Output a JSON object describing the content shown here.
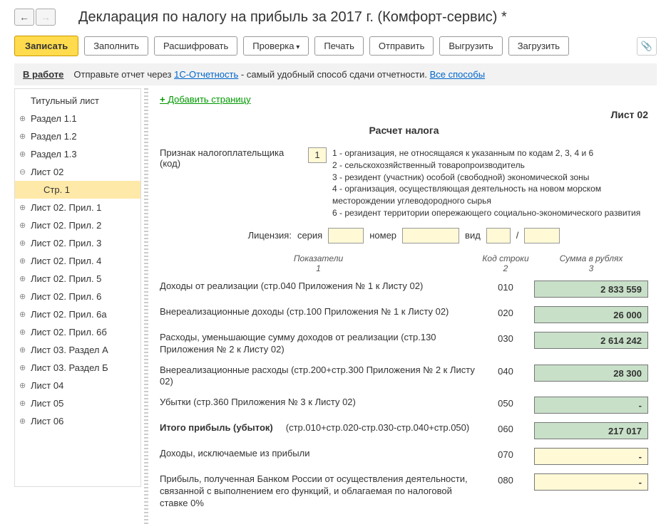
{
  "title": "Декларация по налогу на прибыль за 2017 г. (Комфорт-сервис) *",
  "toolbar": {
    "write": "Записать",
    "fill": "Заполнить",
    "decode": "Расшифровать",
    "check": "Проверка",
    "print": "Печать",
    "send": "Отправить",
    "export": "Выгрузить",
    "import": "Загрузить"
  },
  "info": {
    "status": "В работе",
    "text1": "Отправьте отчет через ",
    "link1": "1С-Отчетность",
    "text2": " - самый удобный способ сдачи отчетности. ",
    "link2": "Все способы"
  },
  "tree": [
    {
      "label": "Титульный лист",
      "lvl": 1,
      "exp": ""
    },
    {
      "label": "Раздел 1.1",
      "lvl": 1,
      "exp": "⊕"
    },
    {
      "label": "Раздел 1.2",
      "lvl": 1,
      "exp": "⊕"
    },
    {
      "label": "Раздел 1.3",
      "lvl": 1,
      "exp": "⊕"
    },
    {
      "label": "Лист 02",
      "lvl": 1,
      "exp": "⊖"
    },
    {
      "label": "Стр. 1",
      "lvl": 2,
      "exp": "",
      "active": true
    },
    {
      "label": "Лист 02. Прил. 1",
      "lvl": 1,
      "exp": "⊕"
    },
    {
      "label": "Лист 02. Прил. 2",
      "lvl": 1,
      "exp": "⊕"
    },
    {
      "label": "Лист 02. Прил. 3",
      "lvl": 1,
      "exp": "⊕"
    },
    {
      "label": "Лист 02. Прил. 4",
      "lvl": 1,
      "exp": "⊕"
    },
    {
      "label": "Лист 02. Прил. 5",
      "lvl": 1,
      "exp": "⊕"
    },
    {
      "label": "Лист 02. Прил. 6",
      "lvl": 1,
      "exp": "⊕"
    },
    {
      "label": "Лист 02. Прил. 6а",
      "lvl": 1,
      "exp": "⊕"
    },
    {
      "label": "Лист 02. Прил. 6б",
      "lvl": 1,
      "exp": "⊕"
    },
    {
      "label": "Лист 03. Раздел А",
      "lvl": 1,
      "exp": "⊕"
    },
    {
      "label": "Лист 03. Раздел Б",
      "lvl": 1,
      "exp": "⊕"
    },
    {
      "label": "Лист 04",
      "lvl": 1,
      "exp": "⊕"
    },
    {
      "label": "Лист 05",
      "lvl": 1,
      "exp": "⊕"
    },
    {
      "label": "Лист 06",
      "lvl": 1,
      "exp": "⊕"
    }
  ],
  "content": {
    "add_page": "Добавить страницу",
    "sheet": "Лист 02",
    "section_title": "Расчет налога",
    "taxpayer_label": "Признак налогоплательщика (код)",
    "taxpayer_code": "1",
    "notes": [
      "1 - организация, не относящаяся к указанным по кодам 2, 3, 4 и 6",
      "2 - сельскохозяйственный товаропроизводитель",
      "3 - резидент (участник) особой (свободной) экономической зоны",
      "4 - организация, осуществляющая деятельность на новом морском месторождении углеводородного сырья",
      "6 - резидент территории опережающего социально-экономического развития"
    ],
    "license": {
      "label": "Лицензия:",
      "series": "серия",
      "number": "номер",
      "type": "вид",
      "sep": "/"
    },
    "cols": {
      "c1": "Показатели",
      "c1n": "1",
      "c2": "Код строки",
      "c2n": "2",
      "c3": "Сумма в рублях",
      "c3n": "3"
    },
    "rows": [
      {
        "desc": "Доходы от реализации (стр.040 Приложения № 1 к Листу 02)",
        "code": "010",
        "val": "2 833 559",
        "cls": "green"
      },
      {
        "desc": "Внереализационные доходы (стр.100 Приложения № 1 к Листу 02)",
        "code": "020",
        "val": "26 000",
        "cls": "green"
      },
      {
        "desc": "Расходы, уменьшающие сумму доходов от реализации (стр.130 Приложения № 2 к Листу 02)",
        "code": "030",
        "val": "2 614 242",
        "cls": "green"
      },
      {
        "desc": "Внереализационные расходы (стр.200+стр.300 Приложения № 2 к Листу 02)",
        "code": "040",
        "val": "28 300",
        "cls": "green"
      },
      {
        "desc": "Убытки (стр.360 Приложения № 3 к Листу 02)",
        "code": "050",
        "val": "-",
        "cls": "green"
      },
      {
        "desc": "Итого прибыль (убыток)",
        "desc2": "(стр.010+стр.020-стр.030-стр.040+стр.050)",
        "code": "060",
        "val": "217 017",
        "cls": "green",
        "bold": true
      },
      {
        "desc": "Доходы, исключаемые из прибыли",
        "code": "070",
        "val": "-",
        "cls": "yellow"
      },
      {
        "desc": "Прибыль, полученная Банком России от осуществления деятельности, связанной с выполнением его функций, и облагаемая по налоговой ставке 0%",
        "code": "080",
        "val": "-",
        "cls": "yellow"
      }
    ]
  }
}
